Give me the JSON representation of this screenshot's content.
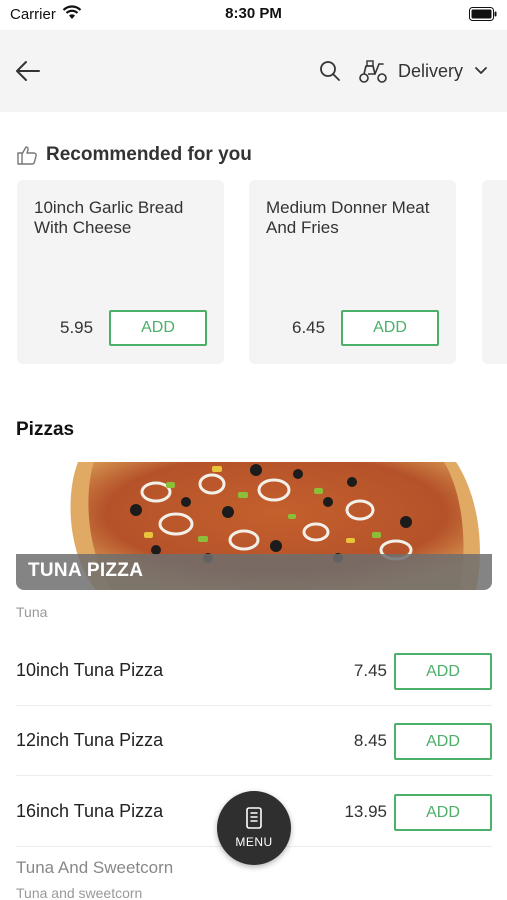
{
  "status_bar": {
    "carrier": "Carrier",
    "time": "8:30 PM"
  },
  "header": {
    "icons": [
      "back-arrow-icon",
      "search-icon",
      "scooter-icon",
      "chevron-down-icon"
    ],
    "delivery_label": "Delivery"
  },
  "recommended": {
    "title": "Recommended for you",
    "icon": "thumbs-up-icon",
    "items": [
      {
        "name": "10inch Garlic Bread With Cheese",
        "price": "5.95",
        "add_label": "ADD"
      },
      {
        "name": "Medium Donner Meat And Fries",
        "price": "6.45",
        "add_label": "ADD"
      }
    ]
  },
  "section": {
    "title": "Pizzas",
    "category_banner": "TUNA PIZZA",
    "category_desc": "Tuna",
    "items": [
      {
        "name": "10inch Tuna Pizza",
        "price": "7.45",
        "add_label": "ADD"
      },
      {
        "name": "12inch Tuna Pizza",
        "price": "8.45",
        "add_label": "ADD"
      },
      {
        "name": "16inch Tuna Pizza",
        "price": "13.95",
        "add_label": "ADD"
      }
    ],
    "next_category": "Tuna And Sweetcorn",
    "next_category_desc": "Tuna and sweetcorn"
  },
  "fab": {
    "label": "MENU",
    "icon": "menu-book-icon"
  },
  "colors": {
    "accent": "#4caf6a",
    "header_bg": "#f4f4f4",
    "fab_bg": "#2f2f2f"
  }
}
